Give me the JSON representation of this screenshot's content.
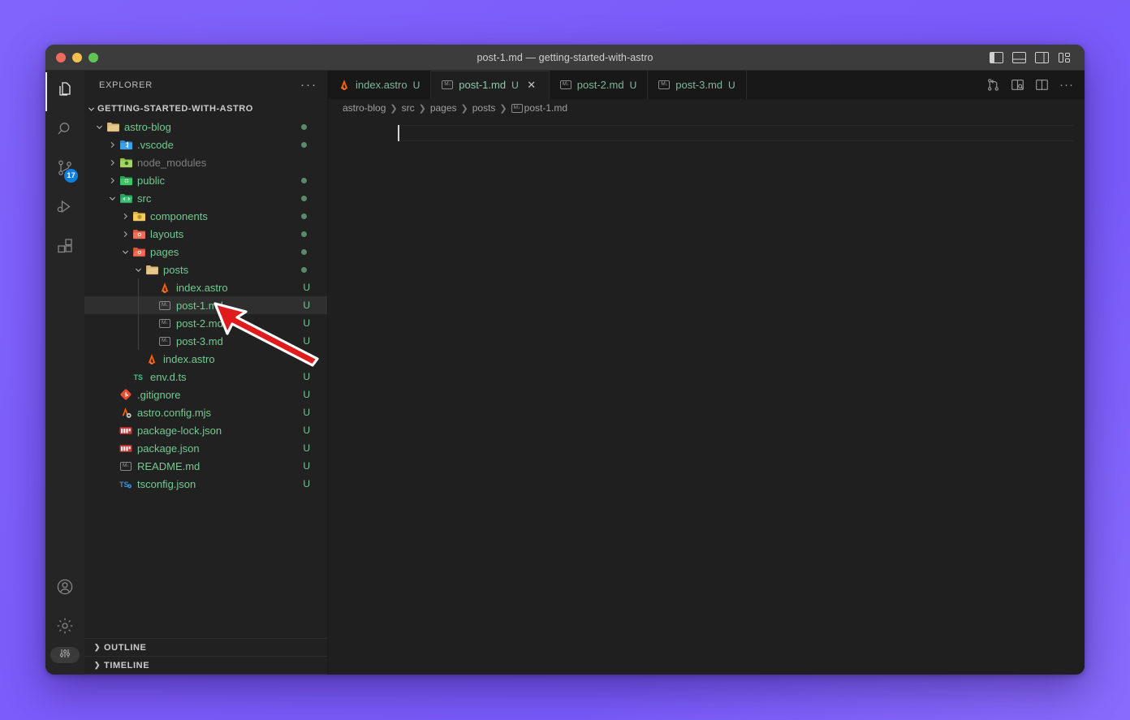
{
  "window": {
    "title": "post-1.md — getting-started-with-astro",
    "traffic_lights": [
      "close-red",
      "minimize-yellow",
      "maximize-green"
    ],
    "layout_toggles": [
      {
        "name": "toggle-primary-sidebar",
        "label": "Toggle Primary Side Bar"
      },
      {
        "name": "toggle-panel",
        "label": "Toggle Panel"
      },
      {
        "name": "toggle-secondary-sidebar",
        "label": "Toggle Secondary Side Bar"
      },
      {
        "name": "customize-layout",
        "label": "Customize Layout"
      }
    ]
  },
  "activity_bar": {
    "items": [
      {
        "name": "explorer",
        "icon": "files-icon",
        "active": true,
        "badge": null
      },
      {
        "name": "search",
        "icon": "search-icon",
        "active": false,
        "badge": null
      },
      {
        "name": "source-control",
        "icon": "source-control-icon",
        "active": false,
        "badge": "17"
      },
      {
        "name": "run-and-debug",
        "icon": "run-debug-icon",
        "active": false,
        "badge": null
      },
      {
        "name": "extensions",
        "icon": "extensions-icon",
        "active": false,
        "badge": null
      }
    ],
    "bottom_items": [
      {
        "name": "accounts",
        "icon": "account-icon"
      },
      {
        "name": "manage-settings",
        "icon": "gear-icon"
      },
      {
        "name": "settings-pill",
        "icon": "sliders-icon"
      }
    ]
  },
  "sidebar": {
    "header": "EXPLORER",
    "more_actions": "···",
    "root": "GETTING-STARTED-WITH-ASTRO",
    "tree": [
      {
        "label": "astro-blog",
        "depth": 1,
        "type": "folder",
        "state": "expanded",
        "icon": "folder-open-icon",
        "status": null,
        "dot": true,
        "dim": false
      },
      {
        "label": ".vscode",
        "depth": 2,
        "type": "folder",
        "state": "collapsed",
        "icon": "folder-vscode-icon",
        "status": null,
        "dot": true,
        "dim": false
      },
      {
        "label": "node_modules",
        "depth": 2,
        "type": "folder",
        "state": "collapsed",
        "icon": "folder-node-icon",
        "status": null,
        "dot": false,
        "dim": true
      },
      {
        "label": "public",
        "depth": 2,
        "type": "folder",
        "state": "collapsed",
        "icon": "folder-public-icon",
        "status": null,
        "dot": true,
        "dim": false
      },
      {
        "label": "src",
        "depth": 2,
        "type": "folder",
        "state": "expanded",
        "icon": "folder-src-icon",
        "status": null,
        "dot": true,
        "dim": false
      },
      {
        "label": "components",
        "depth": 3,
        "type": "folder",
        "state": "collapsed",
        "icon": "folder-components-icon",
        "status": null,
        "dot": true,
        "dim": false
      },
      {
        "label": "layouts",
        "depth": 3,
        "type": "folder",
        "state": "collapsed",
        "icon": "folder-layouts-icon",
        "status": null,
        "dot": true,
        "dim": false
      },
      {
        "label": "pages",
        "depth": 3,
        "type": "folder",
        "state": "expanded",
        "icon": "folder-pages-icon",
        "status": null,
        "dot": true,
        "dim": false
      },
      {
        "label": "posts",
        "depth": 4,
        "type": "folder",
        "state": "expanded",
        "icon": "folder-open-icon",
        "status": null,
        "dot": true,
        "dim": false
      },
      {
        "label": "index.astro",
        "depth": 5,
        "type": "file",
        "state": null,
        "icon": "astro-icon",
        "status": "U",
        "dot": false,
        "dim": false
      },
      {
        "label": "post-1.md",
        "depth": 5,
        "type": "file",
        "state": null,
        "icon": "markdown-icon",
        "status": "U",
        "dot": false,
        "dim": false,
        "selected": true
      },
      {
        "label": "post-2.md",
        "depth": 5,
        "type": "file",
        "state": null,
        "icon": "markdown-icon",
        "status": "U",
        "dot": false,
        "dim": false
      },
      {
        "label": "post-3.md",
        "depth": 5,
        "type": "file",
        "state": null,
        "icon": "markdown-icon",
        "status": "U",
        "dot": false,
        "dim": false
      },
      {
        "label": "index.astro",
        "depth": 4,
        "type": "file",
        "state": null,
        "icon": "astro-icon",
        "status": null,
        "dot": false,
        "dim": false
      },
      {
        "label": "env.d.ts",
        "depth": 3,
        "type": "file",
        "state": null,
        "icon": "typescript-icon",
        "status": "U",
        "dot": false,
        "dim": false
      },
      {
        "label": ".gitignore",
        "depth": 2,
        "type": "file",
        "state": null,
        "icon": "git-icon",
        "status": "U",
        "dot": false,
        "dim": false
      },
      {
        "label": "astro.config.mjs",
        "depth": 2,
        "type": "file",
        "state": null,
        "icon": "astro-config-icon",
        "status": "U",
        "dot": false,
        "dim": false
      },
      {
        "label": "package-lock.json",
        "depth": 2,
        "type": "file",
        "state": null,
        "icon": "npm-icon",
        "status": "U",
        "dot": false,
        "dim": false
      },
      {
        "label": "package.json",
        "depth": 2,
        "type": "file",
        "state": null,
        "icon": "npm-icon",
        "status": "U",
        "dot": false,
        "dim": false
      },
      {
        "label": "README.md",
        "depth": 2,
        "type": "file",
        "state": null,
        "icon": "markdown-icon",
        "status": "U",
        "dot": false,
        "dim": false
      },
      {
        "label": "tsconfig.json",
        "depth": 2,
        "type": "file",
        "state": null,
        "icon": "tsconfig-icon",
        "status": "U",
        "dot": false,
        "dim": false
      }
    ],
    "sections": [
      {
        "label": "OUTLINE",
        "expanded": false
      },
      {
        "label": "TIMELINE",
        "expanded": false
      }
    ]
  },
  "editor": {
    "tabs": [
      {
        "label": "index.astro",
        "icon": "astro-icon",
        "status": "U",
        "active": false,
        "closable": false
      },
      {
        "label": "post-1.md",
        "icon": "markdown-icon",
        "status": "U",
        "active": true,
        "closable": true,
        "close": "✕"
      },
      {
        "label": "post-2.md",
        "icon": "markdown-icon",
        "status": "U",
        "active": false,
        "closable": false
      },
      {
        "label": "post-3.md",
        "icon": "markdown-icon",
        "status": "U",
        "active": false,
        "closable": false
      }
    ],
    "tab_actions": [
      {
        "name": "run-or-compare-icon",
        "label": "Compare"
      },
      {
        "name": "open-preview-icon",
        "label": "Open Preview to the Side"
      },
      {
        "name": "split-editor-icon",
        "label": "Split Editor Right"
      },
      {
        "name": "more-actions-icon",
        "label": "···"
      }
    ],
    "breadcrumb": [
      {
        "label": "astro-blog",
        "icon": null
      },
      {
        "label": "src",
        "icon": null
      },
      {
        "label": "pages",
        "icon": null
      },
      {
        "label": "posts",
        "icon": null
      },
      {
        "label": "post-1.md",
        "icon": "markdown-icon"
      }
    ],
    "breadcrumb_separator": "❯",
    "content": "",
    "cursor_line": 1,
    "cursor_column": 1
  },
  "annotation": {
    "type": "arrow",
    "color": "#e01b1b",
    "outline_color": "#ffffff",
    "points_to": "post-1.md"
  },
  "colors": {
    "desktop_background": "#7c5cfa",
    "window_background": "#1f1f1f",
    "sidebar_background": "#212121",
    "activity_bar_background": "#252526",
    "titlebar_background": "#3c3c3c",
    "accent_badge": "#0a7fe0",
    "file_green": "#73c991",
    "git_dot": "#5a8a6d",
    "selection": "#2f2f2f"
  }
}
